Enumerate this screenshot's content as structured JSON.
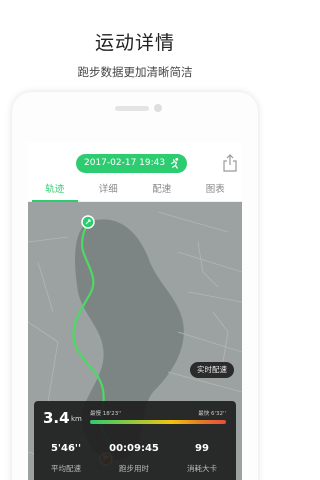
{
  "promo": {
    "title": "运动详情",
    "subtitle": "跑步数据更加清晰简洁"
  },
  "header": {
    "date": "2017-02-17 19:43",
    "pill_icon": "runner-icon",
    "share_icon": "share-icon"
  },
  "tabs": [
    {
      "label": "轨迹",
      "active": true
    },
    {
      "label": "详细",
      "active": false
    },
    {
      "label": "配速",
      "active": false
    },
    {
      "label": "图表",
      "active": false
    }
  ],
  "map": {
    "realtime_button": "实时配速",
    "start_icon": "runner-start-icon",
    "end_icon": "flag-end-icon",
    "route_color": "#4cd964"
  },
  "stats": {
    "distance": "3.4",
    "distance_unit": "km",
    "slowest_label": "最慢 18'23''",
    "fastest_label": "最快 6'32''",
    "items": [
      {
        "value": "5'46''",
        "label": "平均配速"
      },
      {
        "value": "00:09:45",
        "label": "跑步用时"
      },
      {
        "value": "99",
        "label": "消耗大卡"
      }
    ]
  },
  "colors": {
    "accent": "#2ecc71"
  }
}
